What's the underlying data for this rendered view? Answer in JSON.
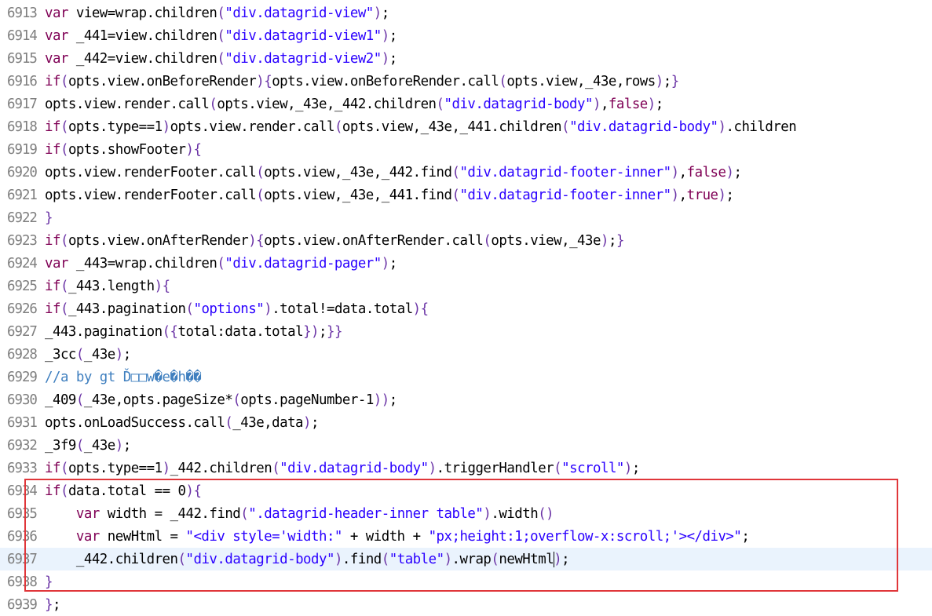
{
  "editor": {
    "current_line": "6937",
    "lines": [
      {
        "n": "6913",
        "t": [
          [
            "kw",
            "var"
          ],
          [
            "txt",
            " view=wrap.children"
          ],
          [
            "pn",
            "("
          ],
          [
            "str",
            "\"div.datagrid-view\""
          ],
          [
            "pn",
            ")"
          ],
          [
            "txt",
            ";"
          ]
        ]
      },
      {
        "n": "6914",
        "t": [
          [
            "kw",
            "var"
          ],
          [
            "txt",
            " _441=view.children"
          ],
          [
            "pn",
            "("
          ],
          [
            "str",
            "\"div.datagrid-view1\""
          ],
          [
            "pn",
            ")"
          ],
          [
            "txt",
            ";"
          ]
        ]
      },
      {
        "n": "6915",
        "t": [
          [
            "kw",
            "var"
          ],
          [
            "txt",
            " _442=view.children"
          ],
          [
            "pn",
            "("
          ],
          [
            "str",
            "\"div.datagrid-view2\""
          ],
          [
            "pn",
            ")"
          ],
          [
            "txt",
            ";"
          ]
        ]
      },
      {
        "n": "6916",
        "t": [
          [
            "kw",
            "if"
          ],
          [
            "pn",
            "("
          ],
          [
            "txt",
            "opts.view.onBeforeRender"
          ],
          [
            "pn",
            ")"
          ],
          [
            "pn",
            "{"
          ],
          [
            "txt",
            "opts.view.onBeforeRender.call"
          ],
          [
            "pn",
            "("
          ],
          [
            "txt",
            "opts.view,_43e,rows"
          ],
          [
            "pn",
            ")"
          ],
          [
            "txt",
            ";"
          ],
          [
            "pn",
            "}"
          ]
        ]
      },
      {
        "n": "6917",
        "t": [
          [
            "txt",
            "opts.view.render.call"
          ],
          [
            "pn",
            "("
          ],
          [
            "txt",
            "opts.view,_43e,_442.children"
          ],
          [
            "pn",
            "("
          ],
          [
            "str",
            "\"div.datagrid-body\""
          ],
          [
            "pn",
            ")"
          ],
          [
            "txt",
            ","
          ],
          [
            "kw",
            "false"
          ],
          [
            "pn",
            ")"
          ],
          [
            "txt",
            ";"
          ]
        ]
      },
      {
        "n": "6918",
        "t": [
          [
            "kw",
            "if"
          ],
          [
            "pn",
            "("
          ],
          [
            "txt",
            "opts.type==1"
          ],
          [
            "pn",
            ")"
          ],
          [
            "txt",
            "opts.view.render.call"
          ],
          [
            "pn",
            "("
          ],
          [
            "txt",
            "opts.view,_43e,_441.children"
          ],
          [
            "pn",
            "("
          ],
          [
            "str",
            "\"div.datagrid-body\""
          ],
          [
            "pn",
            ")"
          ],
          [
            "txt",
            ".children"
          ]
        ]
      },
      {
        "n": "6919",
        "t": [
          [
            "kw",
            "if"
          ],
          [
            "pn",
            "("
          ],
          [
            "txt",
            "opts.showFooter"
          ],
          [
            "pn",
            ")"
          ],
          [
            "pn",
            "{"
          ]
        ]
      },
      {
        "n": "6920",
        "t": [
          [
            "txt",
            "opts.view.renderFooter.call"
          ],
          [
            "pn",
            "("
          ],
          [
            "txt",
            "opts.view,_43e,_442.find"
          ],
          [
            "pn",
            "("
          ],
          [
            "str",
            "\"div.datagrid-footer-inner\""
          ],
          [
            "pn",
            ")"
          ],
          [
            "txt",
            ","
          ],
          [
            "kw",
            "false"
          ],
          [
            "pn",
            ")"
          ],
          [
            "txt",
            ";"
          ]
        ]
      },
      {
        "n": "6921",
        "t": [
          [
            "txt",
            "opts.view.renderFooter.call"
          ],
          [
            "pn",
            "("
          ],
          [
            "txt",
            "opts.view,_43e,_441.find"
          ],
          [
            "pn",
            "("
          ],
          [
            "str",
            "\"div.datagrid-footer-inner\""
          ],
          [
            "pn",
            ")"
          ],
          [
            "txt",
            ","
          ],
          [
            "kw",
            "true"
          ],
          [
            "pn",
            ")"
          ],
          [
            "txt",
            ";"
          ]
        ]
      },
      {
        "n": "6922",
        "t": [
          [
            "pn",
            "}"
          ]
        ]
      },
      {
        "n": "6923",
        "t": [
          [
            "kw",
            "if"
          ],
          [
            "pn",
            "("
          ],
          [
            "txt",
            "opts.view.onAfterRender"
          ],
          [
            "pn",
            ")"
          ],
          [
            "pn",
            "{"
          ],
          [
            "txt",
            "opts.view.onAfterRender.call"
          ],
          [
            "pn",
            "("
          ],
          [
            "txt",
            "opts.view,_43e"
          ],
          [
            "pn",
            ")"
          ],
          [
            "txt",
            ";"
          ],
          [
            "pn",
            "}"
          ]
        ]
      },
      {
        "n": "6924",
        "t": [
          [
            "kw",
            "var"
          ],
          [
            "txt",
            " _443=wrap.children"
          ],
          [
            "pn",
            "("
          ],
          [
            "str",
            "\"div.datagrid-pager\""
          ],
          [
            "pn",
            ")"
          ],
          [
            "txt",
            ";"
          ]
        ]
      },
      {
        "n": "6925",
        "t": [
          [
            "kw",
            "if"
          ],
          [
            "pn",
            "("
          ],
          [
            "txt",
            "_443.length"
          ],
          [
            "pn",
            ")"
          ],
          [
            "pn",
            "{"
          ]
        ]
      },
      {
        "n": "6926",
        "t": [
          [
            "kw",
            "if"
          ],
          [
            "pn",
            "("
          ],
          [
            "txt",
            "_443.pagination"
          ],
          [
            "pn",
            "("
          ],
          [
            "str",
            "\"options\""
          ],
          [
            "pn",
            ")"
          ],
          [
            "txt",
            ".total!=data.total"
          ],
          [
            "pn",
            ")"
          ],
          [
            "pn",
            "{"
          ]
        ]
      },
      {
        "n": "6927",
        "t": [
          [
            "txt",
            "_443.pagination"
          ],
          [
            "pn",
            "("
          ],
          [
            "pn",
            "{"
          ],
          [
            "txt",
            "total:data.total"
          ],
          [
            "pn",
            "}"
          ],
          [
            "pn",
            ")"
          ],
          [
            "txt",
            ";"
          ],
          [
            "pn",
            "}"
          ],
          [
            "pn",
            "}"
          ]
        ]
      },
      {
        "n": "6928",
        "t": [
          [
            "txt",
            "_3cc"
          ],
          [
            "pn",
            "("
          ],
          [
            "txt",
            "_43e"
          ],
          [
            "pn",
            ")"
          ],
          [
            "txt",
            ";"
          ]
        ]
      },
      {
        "n": "6929",
        "t": [
          [
            "cm",
            "//a by gt Ď□□w�e�h��"
          ]
        ]
      },
      {
        "n": "6930",
        "t": [
          [
            "txt",
            "_409"
          ],
          [
            "pn",
            "("
          ],
          [
            "txt",
            "_43e,opts.pageSize*"
          ],
          [
            "pn",
            "("
          ],
          [
            "txt",
            "opts.pageNumber-1"
          ],
          [
            "pn",
            ")"
          ],
          [
            "pn",
            ")"
          ],
          [
            "txt",
            ";"
          ]
        ]
      },
      {
        "n": "6931",
        "t": [
          [
            "txt",
            "opts.onLoadSuccess.call"
          ],
          [
            "pn",
            "("
          ],
          [
            "txt",
            "_43e,data"
          ],
          [
            "pn",
            ")"
          ],
          [
            "txt",
            ";"
          ]
        ]
      },
      {
        "n": "6932",
        "t": [
          [
            "txt",
            "_3f9"
          ],
          [
            "pn",
            "("
          ],
          [
            "txt",
            "_43e"
          ],
          [
            "pn",
            ")"
          ],
          [
            "txt",
            ";"
          ]
        ]
      },
      {
        "n": "6933",
        "t": [
          [
            "kw",
            "if"
          ],
          [
            "pn",
            "("
          ],
          [
            "txt",
            "opts.type==1"
          ],
          [
            "pn",
            ")"
          ],
          [
            "txt",
            "_442.children"
          ],
          [
            "pn",
            "("
          ],
          [
            "str",
            "\"div.datagrid-body\""
          ],
          [
            "pn",
            ")"
          ],
          [
            "txt",
            ".triggerHandler"
          ],
          [
            "pn",
            "("
          ],
          [
            "str",
            "\"scroll\""
          ],
          [
            "pn",
            ")"
          ],
          [
            "txt",
            ";"
          ]
        ]
      },
      {
        "n": "6934",
        "t": [
          [
            "kw",
            "if"
          ],
          [
            "pn",
            "("
          ],
          [
            "txt",
            "data.total == 0"
          ],
          [
            "pn",
            ")"
          ],
          [
            "pn",
            "{"
          ]
        ]
      },
      {
        "n": "6935",
        "t": [
          [
            "ws",
            "    "
          ],
          [
            "kw",
            "var"
          ],
          [
            "txt",
            " width = _442.find"
          ],
          [
            "pn",
            "("
          ],
          [
            "str",
            "\".datagrid-header-inner table\""
          ],
          [
            "pn",
            ")"
          ],
          [
            "txt",
            ".width"
          ],
          [
            "pn",
            "("
          ],
          [
            "pn",
            ")"
          ]
        ]
      },
      {
        "n": "6936",
        "t": [
          [
            "ws",
            "    "
          ],
          [
            "kw",
            "var"
          ],
          [
            "txt",
            " newHtml = "
          ],
          [
            "str",
            "\"<div style='width:\""
          ],
          [
            "txt",
            " + width + "
          ],
          [
            "str",
            "\"px;height:1;overflow-x:scroll;'></div>\""
          ],
          [
            "txt",
            ";"
          ]
        ]
      },
      {
        "n": "6937",
        "t": [
          [
            "ws",
            "    "
          ],
          [
            "txt",
            "_442.children"
          ],
          [
            "pn",
            "("
          ],
          [
            "str",
            "\"div.datagrid-body\""
          ],
          [
            "pn",
            ")"
          ],
          [
            "txt",
            ".find"
          ],
          [
            "pn",
            "("
          ],
          [
            "str",
            "\"table\""
          ],
          [
            "pn",
            ")"
          ],
          [
            "txt",
            ".wrap"
          ],
          [
            "pn",
            "("
          ],
          [
            "txt",
            "newHtml"
          ],
          [
            "pn",
            ")"
          ],
          [
            "txt",
            ";"
          ]
        ]
      },
      {
        "n": "6938",
        "t": [
          [
            "pn",
            "}"
          ]
        ]
      },
      {
        "n": "6939",
        "t": [
          [
            "pn",
            "}"
          ],
          [
            "txt",
            ";"
          ]
        ]
      }
    ]
  }
}
